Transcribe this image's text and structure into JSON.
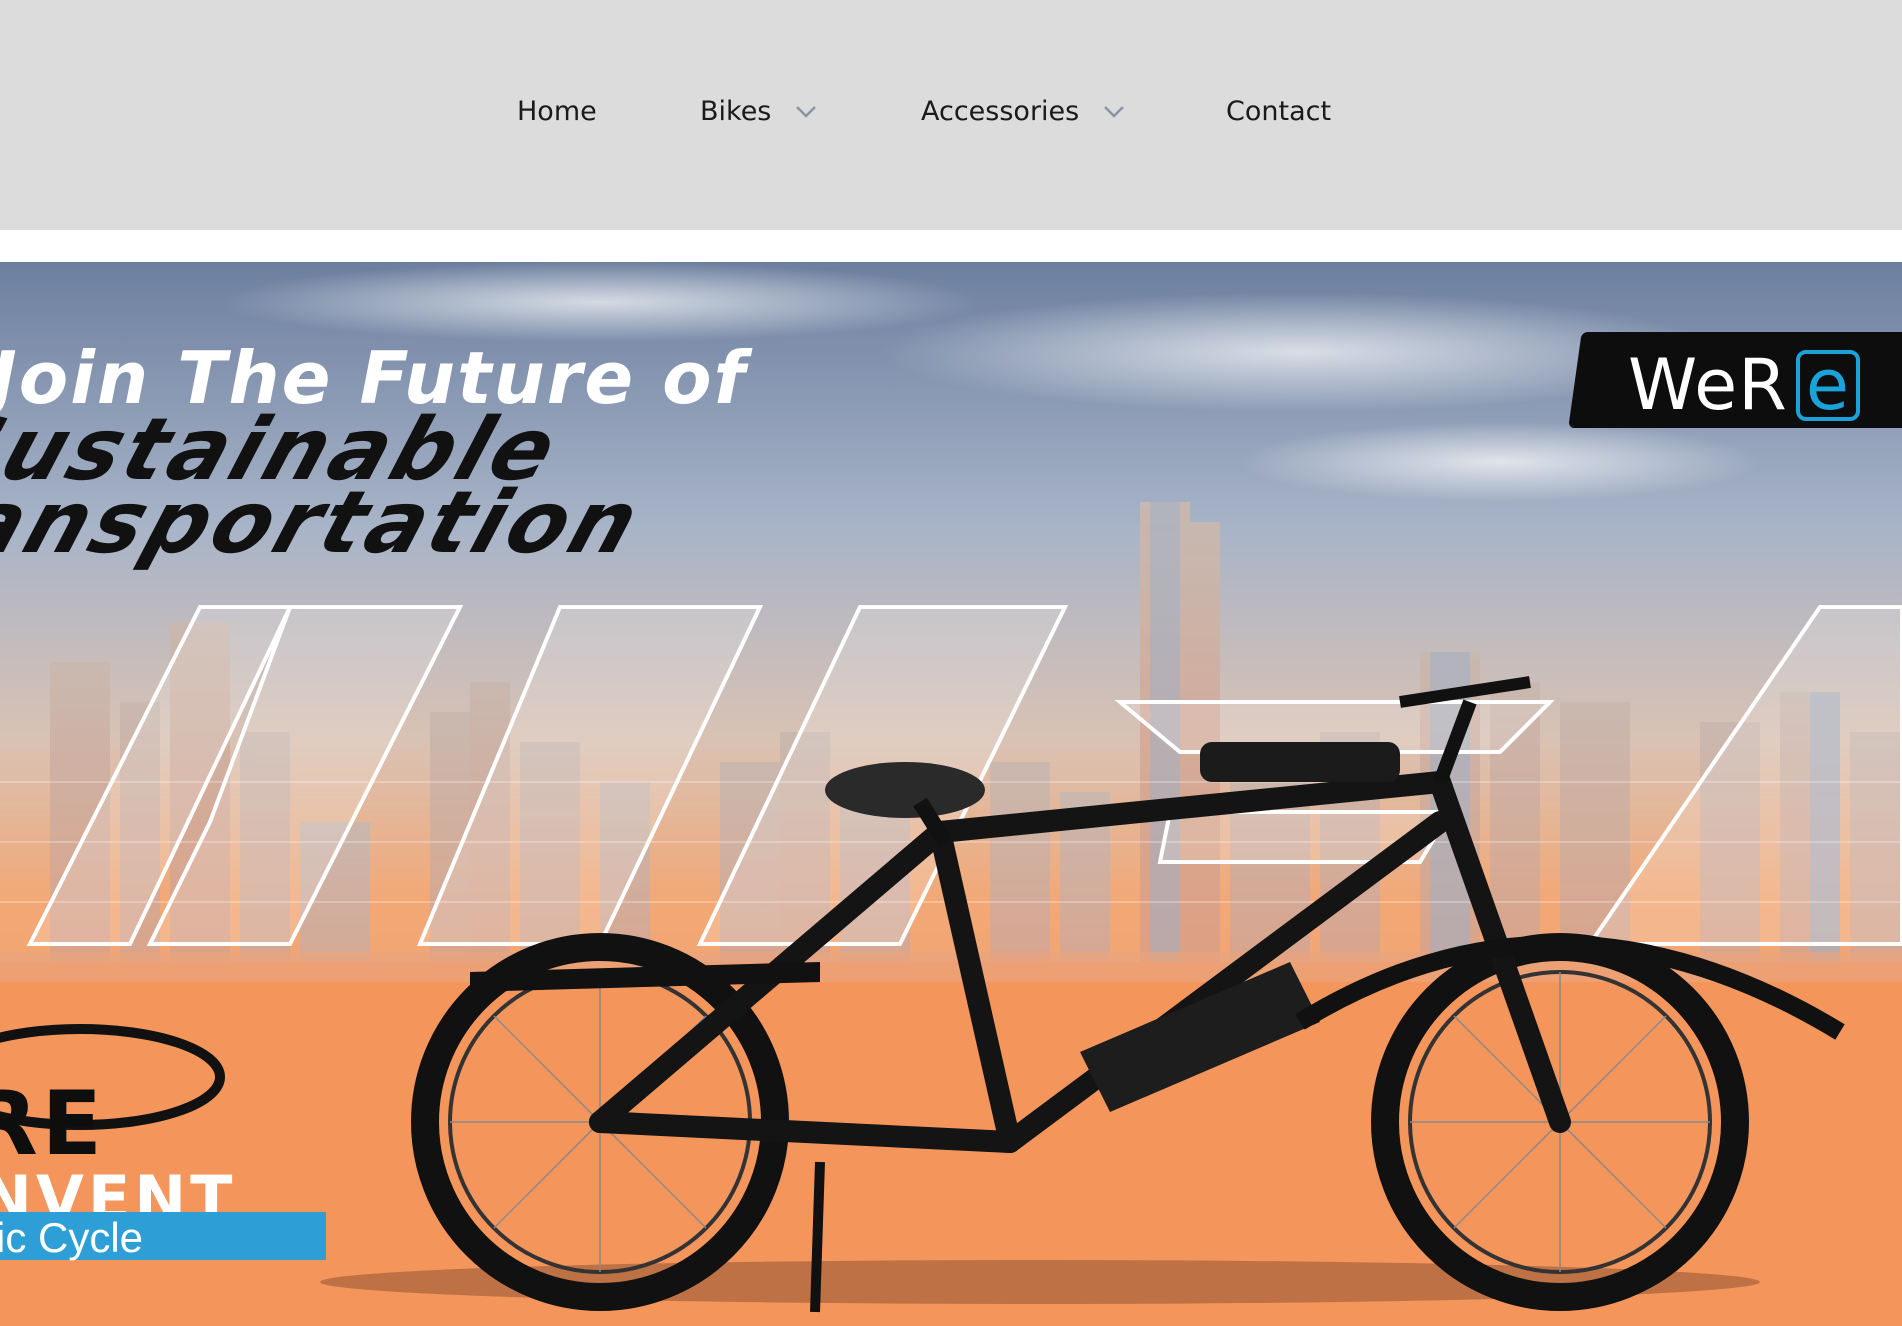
{
  "nav": {
    "items": [
      {
        "label": "Home",
        "has_dropdown": false
      },
      {
        "label": "Bikes",
        "has_dropdown": true
      },
      {
        "label": "Accessories",
        "has_dropdown": true
      },
      {
        "label": "Contact",
        "has_dropdown": false
      }
    ],
    "background": "#dcdcdc",
    "text_color": "#1a1a1a",
    "chevron_color": "#8a94a6"
  },
  "hero": {
    "headline_line1": "Join The Future of",
    "headline_line2": "Sustainable",
    "headline_line3": "ransportation",
    "logo_text": "WeR",
    "logo_accent": "e",
    "brand_mark": "RE",
    "brand_name": "NVENT",
    "brand_tagline": "ic Cycle",
    "colors": {
      "sky_top": "#6c7f9f",
      "ground": "#f4965c",
      "accent_blue": "#1aa3d9"
    }
  }
}
